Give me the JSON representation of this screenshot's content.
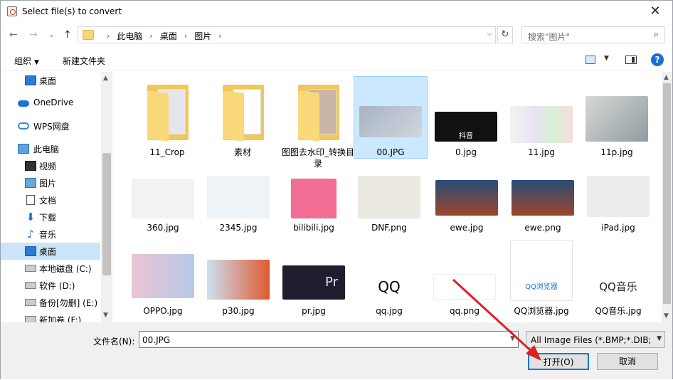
{
  "window": {
    "title": "Select file(s) to convert",
    "close_glyph": "✕"
  },
  "nav": {
    "back": "←",
    "forward": "→",
    "recent": "⌄",
    "up": "↑",
    "breadcrumb": [
      "此电脑",
      "桌面",
      "图片"
    ],
    "refresh": "↻",
    "search_placeholder": "搜索\"图片\"",
    "search_glyph": "⌕"
  },
  "toolbar": {
    "organize": "组织",
    "new_folder": "新建文件夹",
    "help": "?"
  },
  "sidebar": {
    "items": [
      {
        "label": "桌面",
        "icon": "desktop-icon"
      },
      {
        "label": "OneDrive",
        "icon": "cloud-icon"
      },
      {
        "label": "WPS网盘",
        "icon": "wps-cloud-icon"
      },
      {
        "label": "此电脑",
        "icon": "computer-icon"
      },
      {
        "label": "视频",
        "icon": "video-icon"
      },
      {
        "label": "图片",
        "icon": "picture-icon"
      },
      {
        "label": "文档",
        "icon": "document-icon"
      },
      {
        "label": "下载",
        "icon": "download-icon"
      },
      {
        "label": "音乐",
        "icon": "music-icon"
      },
      {
        "label": "桌面",
        "icon": "desktop-icon"
      },
      {
        "label": "本地磁盘 (C:)",
        "icon": "drive-icon"
      },
      {
        "label": "软件 (D:)",
        "icon": "drive-icon"
      },
      {
        "label": "备份[勿删] (E:)",
        "icon": "drive-icon"
      },
      {
        "label": "新加卷 (F:)",
        "icon": "drive-icon"
      }
    ],
    "selected_index": 9
  },
  "files": [
    {
      "name": "11_Crop",
      "kind": "folder"
    },
    {
      "name": "素材",
      "kind": "folder"
    },
    {
      "name": "图图去水印_转换目录",
      "kind": "folder"
    },
    {
      "name": "00.JPG",
      "kind": "image",
      "selected": true,
      "thumb_text": ""
    },
    {
      "name": "0.jpg",
      "kind": "image",
      "thumb_text": "抖音"
    },
    {
      "name": "11.jpg",
      "kind": "image",
      "thumb_text": ""
    },
    {
      "name": "11p.jpg",
      "kind": "image",
      "thumb_text": ""
    },
    {
      "name": "360.jpg",
      "kind": "image",
      "thumb_text": ""
    },
    {
      "name": "2345.jpg",
      "kind": "image",
      "thumb_text": ""
    },
    {
      "name": "bilibili.jpg",
      "kind": "image",
      "thumb_text": ""
    },
    {
      "name": "DNF.png",
      "kind": "image",
      "thumb_text": ""
    },
    {
      "name": "ewe.jpg",
      "kind": "image",
      "thumb_text": ""
    },
    {
      "name": "ewe.png",
      "kind": "image",
      "thumb_text": ""
    },
    {
      "name": "iPad.jpg",
      "kind": "image",
      "thumb_text": ""
    },
    {
      "name": "OPPO.jpg",
      "kind": "image",
      "thumb_text": ""
    },
    {
      "name": "p30.jpg",
      "kind": "image",
      "thumb_text": ""
    },
    {
      "name": "pr.jpg",
      "kind": "image",
      "thumb_text": "Pr"
    },
    {
      "name": "qq.jpg",
      "kind": "image",
      "thumb_text": "QQ"
    },
    {
      "name": "qq.png",
      "kind": "image",
      "thumb_text": ""
    },
    {
      "name": "QQ浏览器.jpg",
      "kind": "image",
      "thumb_text": "QQ浏览器"
    },
    {
      "name": "QQ音乐.jpg",
      "kind": "image",
      "thumb_text": "QQ音乐"
    }
  ],
  "bottom": {
    "filename_label": "文件名(N):",
    "filename_value": "00.JPG",
    "filter_value": "All Image Files (*.BMP;*.DIB;",
    "open_label": "打开(O)",
    "cancel_label": "取消"
  },
  "colors": {
    "selection": "#cce8ff",
    "sidebar_selection": "#cce4f7",
    "accent": "#0078d7",
    "arrow": "#e02020"
  }
}
